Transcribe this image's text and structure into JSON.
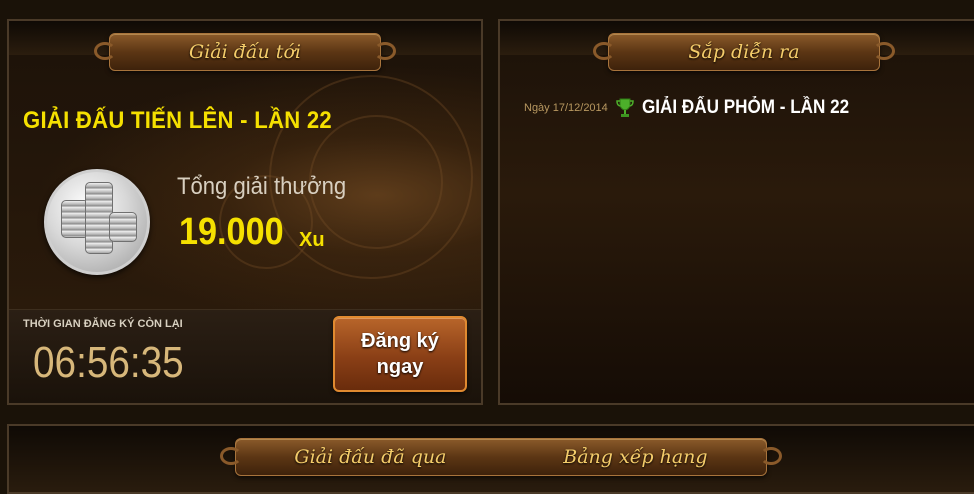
{
  "upcoming": {
    "header_title": "Giải đấu tới",
    "tournament_name": "GIẢI ĐẤU TIẾN LÊN - LẦN 22",
    "coin_icon": "coin-stack-icon",
    "prize_label": "Tổng giải thưởng",
    "prize_amount": "19.000",
    "prize_unit": "Xu",
    "registration_label": "THỜI GIAN ĐĂNG KÝ CÒN LẠI",
    "countdown": "06:56:35",
    "register_button": "Đăng ký\nngay"
  },
  "soon": {
    "header_title": "Sắp diễn ra",
    "items": [
      {
        "date": "Ngày 17/12/2014",
        "icon": "trophy-icon",
        "name": "GIẢI ĐẤU PHỎM - LẦN 22"
      }
    ]
  },
  "bottom": {
    "tabs": [
      {
        "label": "Giải đấu đã qua"
      },
      {
        "label": "Bảng xếp hạng"
      }
    ]
  },
  "colors": {
    "title_yellow": "#f5e000",
    "header_gold": "#f4cc6a",
    "countdown_tan": "#d7b77a",
    "button_orange": "#b8652a",
    "trophy_green": "#4caf2a"
  }
}
